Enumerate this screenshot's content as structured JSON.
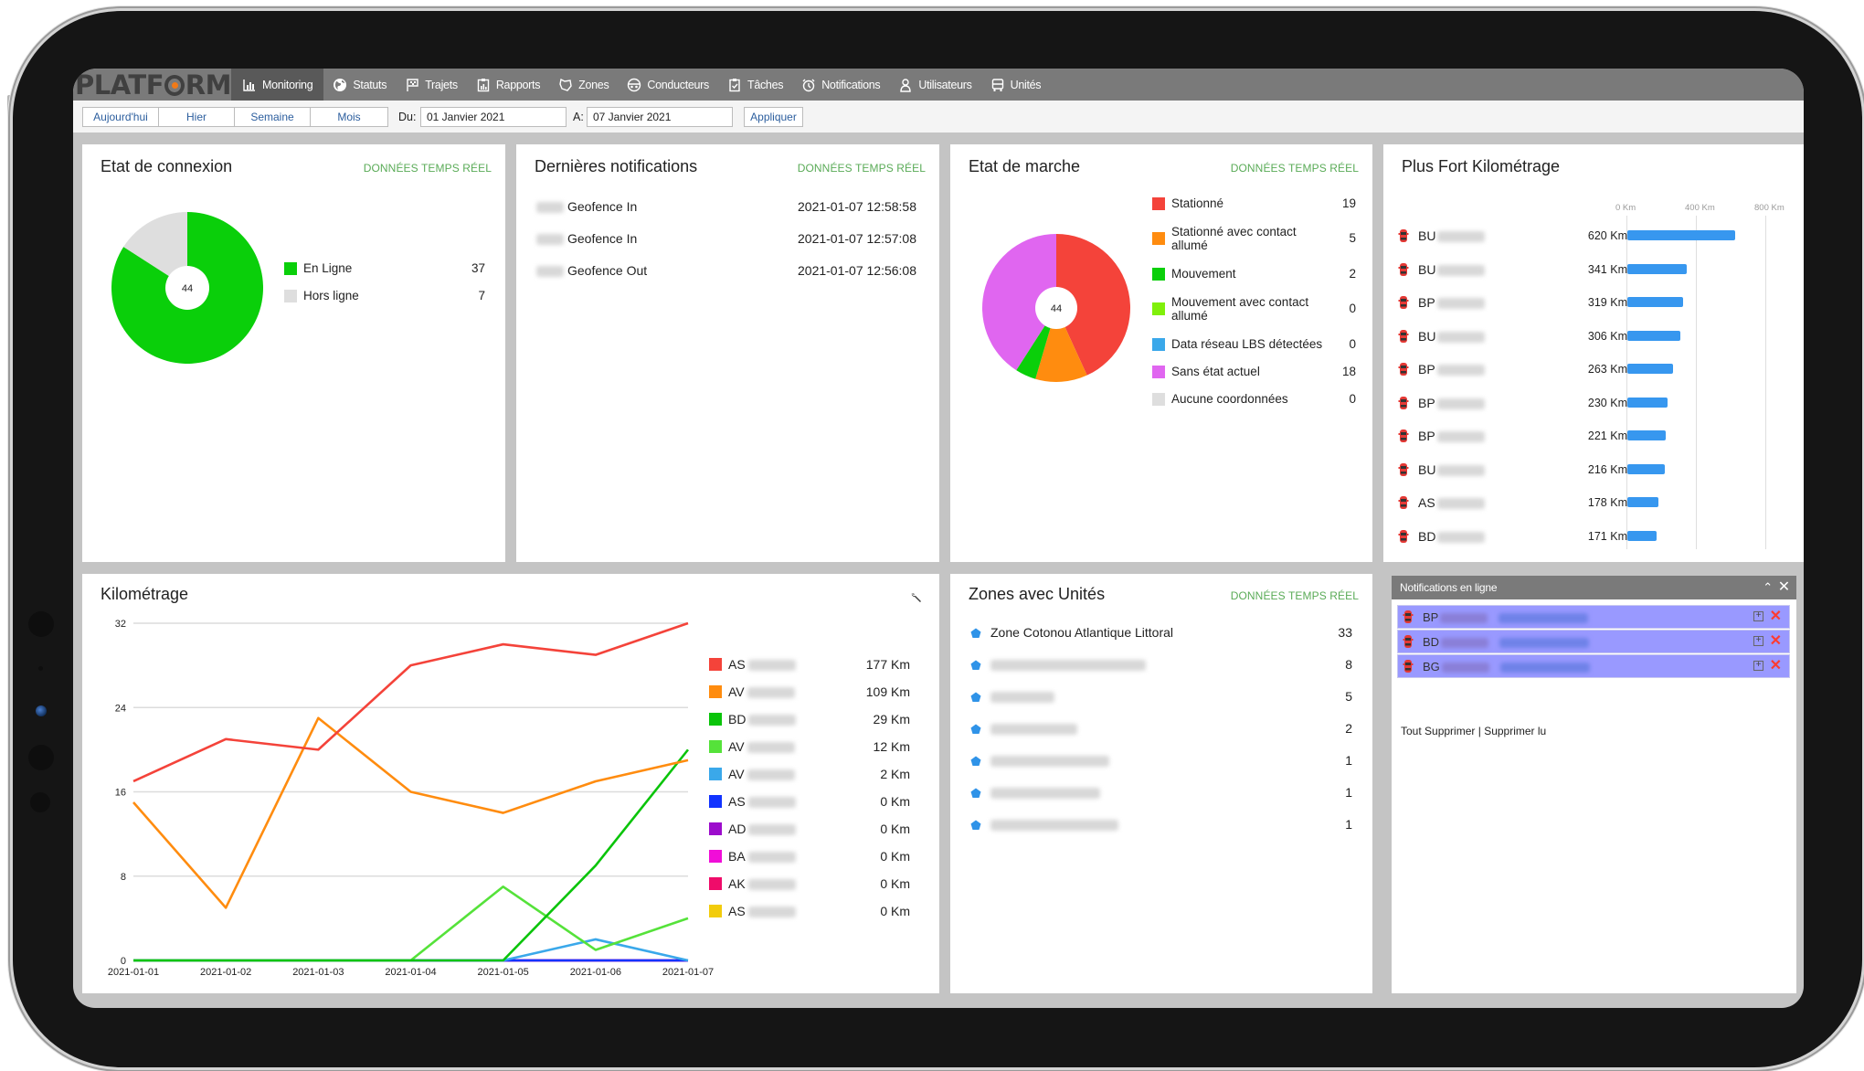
{
  "app": {
    "logo": "PLATFORM",
    "nav": [
      {
        "label": "Monitoring",
        "icon": "bar-chart-icon",
        "active": true
      },
      {
        "label": "Statuts",
        "icon": "globe-icon",
        "active": false
      },
      {
        "label": "Trajets",
        "icon": "flag-icon",
        "active": false
      },
      {
        "label": "Rapports",
        "icon": "report-icon",
        "active": false
      },
      {
        "label": "Zones",
        "icon": "zone-icon",
        "active": false
      },
      {
        "label": "Conducteurs",
        "icon": "driver-icon",
        "active": false
      },
      {
        "label": "Tâches",
        "icon": "task-icon",
        "active": false
      },
      {
        "label": "Notifications",
        "icon": "alarm-icon",
        "active": false
      },
      {
        "label": "Utilisateurs",
        "icon": "user-icon",
        "active": false
      },
      {
        "label": "Unités",
        "icon": "bus-icon",
        "active": false
      }
    ]
  },
  "toolbar": {
    "periods": [
      "Aujourd'hui",
      "Hier",
      "Semaine",
      "Mois"
    ],
    "from_label": "Du:",
    "from_value": "01 Janvier 2021",
    "to_label": "A:",
    "to_value": "07 Janvier 2021",
    "apply_label": "Appliquer"
  },
  "realtime_label": "DONNÉES TEMPS RÉEL",
  "connexion": {
    "title": "Etat de connexion",
    "total": "44",
    "items": [
      {
        "label": "En Ligne",
        "value": 37,
        "color": "#0acf0a"
      },
      {
        "label": "Hors ligne",
        "value": 7,
        "color": "#dedede"
      }
    ]
  },
  "notifications": {
    "title": "Dernières notifications",
    "items": [
      {
        "event": "Geofence In",
        "time": "2021-01-07 12:58:58"
      },
      {
        "event": "Geofence In",
        "time": "2021-01-07 12:57:08"
      },
      {
        "event": "Geofence Out",
        "time": "2021-01-07 12:56:08"
      }
    ]
  },
  "marche": {
    "title": "Etat de marche",
    "total": "44",
    "items": [
      {
        "label": "Stationné",
        "value": 19,
        "color": "#f4433a"
      },
      {
        "label": "Stationné avec contact allumé",
        "value": 5,
        "color": "#ff8c0f"
      },
      {
        "label": "Mouvement",
        "value": 2,
        "color": "#0acf0a"
      },
      {
        "label": "Mouvement avec contact allumé",
        "value": 0,
        "color": "#80f00a"
      },
      {
        "label": "Data réseau LBS détectées",
        "value": 0,
        "color": "#3aa8ea"
      },
      {
        "label": "Sans état actuel",
        "value": 18,
        "color": "#e066f0"
      },
      {
        "label": "Aucune coordonnées",
        "value": 0,
        "color": "#dedede"
      }
    ]
  },
  "top_km": {
    "title": "Plus Fort Kilométrage",
    "axis_ticks": [
      "0 Km",
      "400 Km",
      "800 Km"
    ],
    "axis_max": 800,
    "items": [
      {
        "plate": "BU",
        "value": 620,
        "label": "620 Km"
      },
      {
        "plate": "BU",
        "value": 341,
        "label": "341 Km"
      },
      {
        "plate": "BP",
        "value": 319,
        "label": "319 Km"
      },
      {
        "plate": "BU",
        "value": 306,
        "label": "306 Km"
      },
      {
        "plate": "BP",
        "value": 263,
        "label": "263 Km"
      },
      {
        "plate": "BP",
        "value": 230,
        "label": "230 Km"
      },
      {
        "plate": "BP",
        "value": 221,
        "label": "221 Km"
      },
      {
        "plate": "BU",
        "value": 216,
        "label": "216 Km"
      },
      {
        "plate": "AS",
        "value": 178,
        "label": "178 Km"
      },
      {
        "plate": "BD",
        "value": 171,
        "label": "171 Km"
      }
    ]
  },
  "zones": {
    "title": "Zones avec Unités",
    "items": [
      {
        "name": "Zone Cotonou Atlantique Littoral",
        "count": "33",
        "blurred": false
      },
      {
        "name": "",
        "count": "8",
        "blurred": true
      },
      {
        "name": "",
        "count": "5",
        "blurred": true
      },
      {
        "name": "",
        "count": "2",
        "blurred": true
      },
      {
        "name": "",
        "count": "1",
        "blurred": true
      },
      {
        "name": "",
        "count": "1",
        "blurred": true
      },
      {
        "name": "",
        "count": "1",
        "blurred": true
      }
    ]
  },
  "online_notifications": {
    "title": "Notifications en ligne",
    "items": [
      {
        "plate": "BP"
      },
      {
        "plate": "BD"
      },
      {
        "plate": "BG"
      }
    ],
    "delete_all": "Tout Supprimer",
    "separator": "|",
    "delete_read": "Supprimer lu"
  },
  "chart_data": {
    "type": "line",
    "title": "Kilométrage",
    "x": [
      "2021-01-01",
      "2021-01-02",
      "2021-01-03",
      "2021-01-04",
      "2021-01-05",
      "2021-01-06",
      "2021-01-07"
    ],
    "ylim": [
      0,
      32
    ],
    "yticks": [
      0,
      8,
      16,
      24,
      32
    ],
    "grid": true,
    "legend": "right",
    "series": [
      {
        "name": "AS",
        "total": "177 Km",
        "color": "#f4433a",
        "values": [
          17,
          21,
          20,
          28,
          30,
          29,
          32
        ]
      },
      {
        "name": "AV",
        "total": "109 Km",
        "color": "#ff8c0f",
        "values": [
          15,
          5,
          23,
          16,
          14,
          17,
          19
        ]
      },
      {
        "name": "BD",
        "total": "29 Km",
        "color": "#0ac40a",
        "values": [
          0,
          0,
          0,
          0,
          0,
          9,
          20
        ]
      },
      {
        "name": "AV",
        "total": "12 Km",
        "color": "#55e23a",
        "values": [
          0,
          0,
          0,
          0,
          7,
          1,
          4
        ]
      },
      {
        "name": "AV",
        "total": "2 Km",
        "color": "#3aa8ea",
        "values": [
          0,
          0,
          0,
          0,
          0,
          2,
          0
        ]
      },
      {
        "name": "AS",
        "total": "0 Km",
        "color": "#1133ff",
        "values": [
          0,
          0,
          0,
          0,
          0,
          0,
          0
        ]
      },
      {
        "name": "AD",
        "total": "0 Km",
        "color": "#9c0ccc",
        "values": [
          0,
          0,
          0,
          0,
          0,
          0,
          0
        ]
      },
      {
        "name": "BA",
        "total": "0 Km",
        "color": "#f00ed8",
        "values": [
          0,
          0,
          0,
          0,
          0,
          0,
          0
        ]
      },
      {
        "name": "AK",
        "total": "0 Km",
        "color": "#ef0c6a",
        "values": [
          0,
          0,
          0,
          0,
          0,
          0,
          0
        ]
      },
      {
        "name": "AS",
        "total": "0 Km",
        "color": "#f2cc0c",
        "values": [
          0,
          0,
          0,
          0,
          0,
          0,
          0
        ]
      }
    ]
  }
}
